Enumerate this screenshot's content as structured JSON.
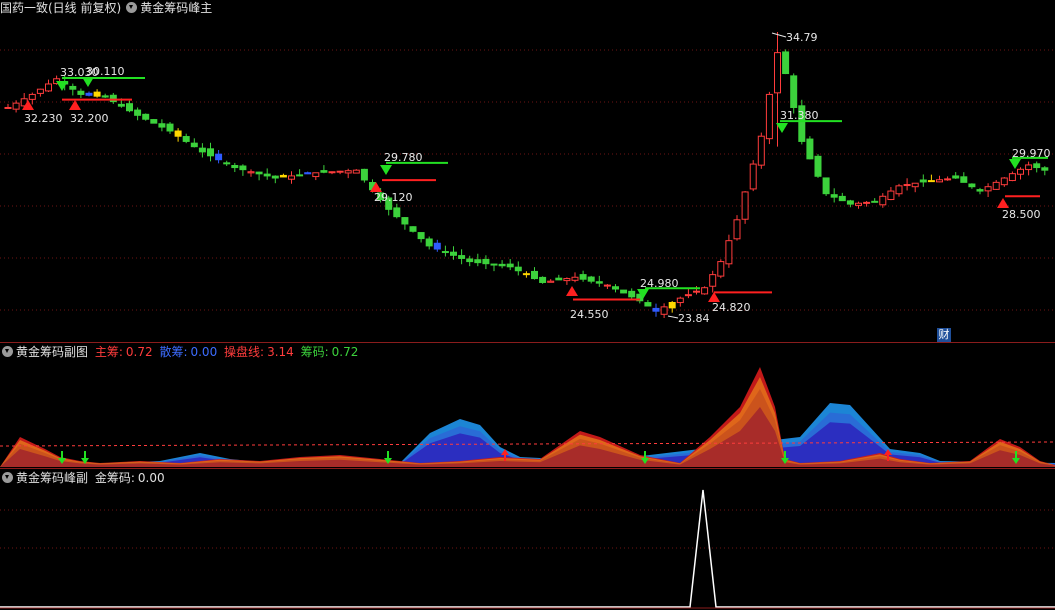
{
  "main_chart": {
    "stock_label": "国药一致(日线 前复权)",
    "indicator_name": "黄金筹码峰主",
    "cai_badge": "财",
    "price_labels": [
      {
        "text": "32.230",
        "anchor": "low"
      },
      {
        "text": "32.200",
        "anchor": "low"
      },
      {
        "text": "33.030",
        "anchor": "high"
      },
      {
        "text": "30.110",
        "anchor": "high"
      },
      {
        "text": "29.780",
        "anchor": "high"
      },
      {
        "text": "29.120",
        "anchor": "low"
      },
      {
        "text": "34.79",
        "anchor": "max"
      },
      {
        "text": "31.380",
        "anchor": "high"
      },
      {
        "text": "24.980",
        "anchor": "high"
      },
      {
        "text": "24.550",
        "anchor": "low"
      },
      {
        "text": "23.84",
        "anchor": "min"
      },
      {
        "text": "24.820",
        "anchor": "low"
      },
      {
        "text": "29.970",
        "anchor": "high"
      },
      {
        "text": "28.500",
        "anchor": "low"
      }
    ],
    "colors": {
      "up": "#ff3c3c",
      "down": "#3cd23c",
      "blue": "#2f5bff",
      "yellow": "#ffd700",
      "grid": "#6e1414",
      "buy_arrow": "#ff2020",
      "sell_arrow": "#22e022"
    }
  },
  "sub_chart_1": {
    "indicator_name": "黄金筹码副图",
    "legend": [
      {
        "label": "主筹:",
        "value": "0.72",
        "color": "#ff3c3c"
      },
      {
        "label": "散筹:",
        "value": "0.00",
        "color": "#3c6cff"
      },
      {
        "label": "操盘线:",
        "value": "3.14",
        "color": "#ff3c3c"
      },
      {
        "label": "筹码:",
        "value": "0.72",
        "color": "#3cd23c"
      }
    ],
    "colors": {
      "red_area": "#a52a2a",
      "blue_area": "#2b2bbf",
      "orange_area": "#e06a1a",
      "cyan_area": "#1e8ce0",
      "dash_line": "#ff3c3c"
    }
  },
  "sub_chart_2": {
    "indicator_name": "黄金筹码峰副",
    "legend": [
      {
        "label": "金筹码:",
        "value": "0.00",
        "color": "#c8c8c8"
      }
    ]
  }
}
